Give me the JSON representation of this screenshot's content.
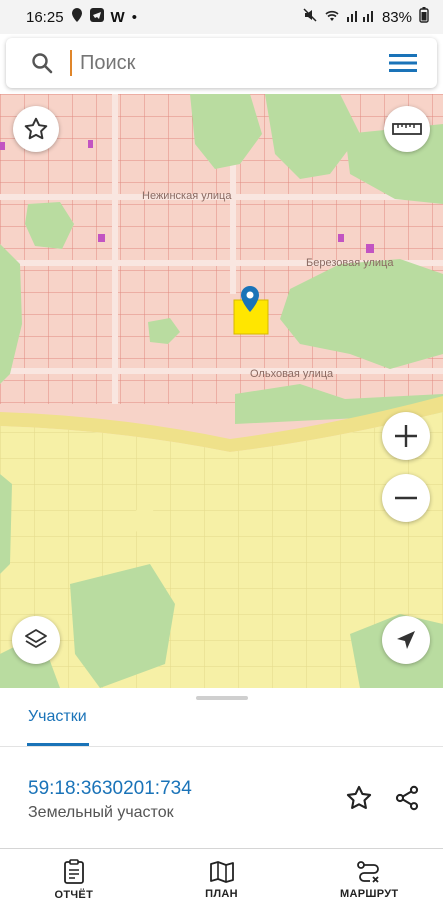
{
  "status": {
    "time": "16:25",
    "battery": "83%"
  },
  "search": {
    "placeholder": "Поиск"
  },
  "map": {
    "streets": [
      "Нежинская улица",
      "Березовая улица",
      "Ольховая улица"
    ]
  },
  "sheet": {
    "tab_label": "Участки",
    "parcel_id": "59:18:3630201:734",
    "parcel_type": "Земельный участок"
  },
  "nav": {
    "report": "ОТЧЁТ",
    "plan": "ПЛАН",
    "route": "МАРШРУТ"
  },
  "colors": {
    "accent": "#1a73b8",
    "residential": "#f7d3c8",
    "parcel_line": "#e08a80",
    "forest": "#b9dca0",
    "garden": "#f6f0a6",
    "selected": "#ffe600"
  }
}
